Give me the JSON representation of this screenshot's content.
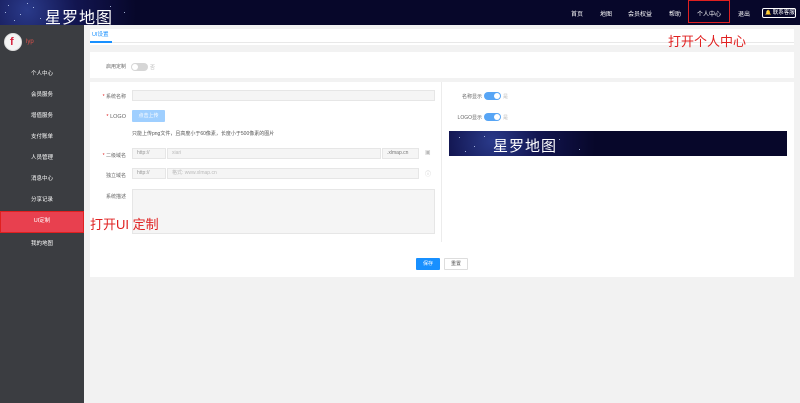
{
  "header": {
    "brand": "星罗地图",
    "nav": [
      "首页",
      "地图",
      "会员权益",
      "帮助",
      "个人中心",
      "退出"
    ],
    "service_label": "联系客服",
    "service_icon": "bell-icon"
  },
  "sidebar": {
    "avatar_letter": "f",
    "username": "lyp",
    "items": [
      {
        "label": "个人中心"
      },
      {
        "label": "会员服务"
      },
      {
        "label": "增值服务"
      },
      {
        "label": "支付账单"
      },
      {
        "label": "人员管理"
      },
      {
        "label": "消息中心"
      },
      {
        "label": "分享记录"
      },
      {
        "label": "UI定制"
      },
      {
        "label": "我的地图"
      }
    ]
  },
  "main": {
    "tab": "UI设置",
    "enable": {
      "label": "启用定制",
      "state": "否"
    },
    "system_name": {
      "label": "系统名称"
    },
    "logo": {
      "label": "LOGO",
      "upload_label": "点击上传",
      "hint": "只能上传png文件，且高度小于60像素，长度小于500像素的图片"
    },
    "subdomain": {
      "label": "二级域名",
      "prefix": "http://",
      "placeholder": "xiari",
      "suffix": ".xlmap.cn"
    },
    "domain": {
      "label": "独立域名",
      "prefix": "http://",
      "placeholder": "格式: www.xlmap.cn"
    },
    "desc": {
      "label": "系统描述"
    },
    "name_display": {
      "label": "名称显示",
      "state": "是"
    },
    "logo_display": {
      "label": "LOGO显示",
      "state": "是"
    },
    "preview_title": "星罗地图",
    "save_label": "保存",
    "reset_label": "重置"
  },
  "annotations": {
    "top": "打开个人中心",
    "side": "打开UI 定制"
  },
  "colors": {
    "accent": "#1890ff",
    "sidebar_active": "#e8404f",
    "annotation": "#e02020",
    "header_bg": "#07072a"
  }
}
